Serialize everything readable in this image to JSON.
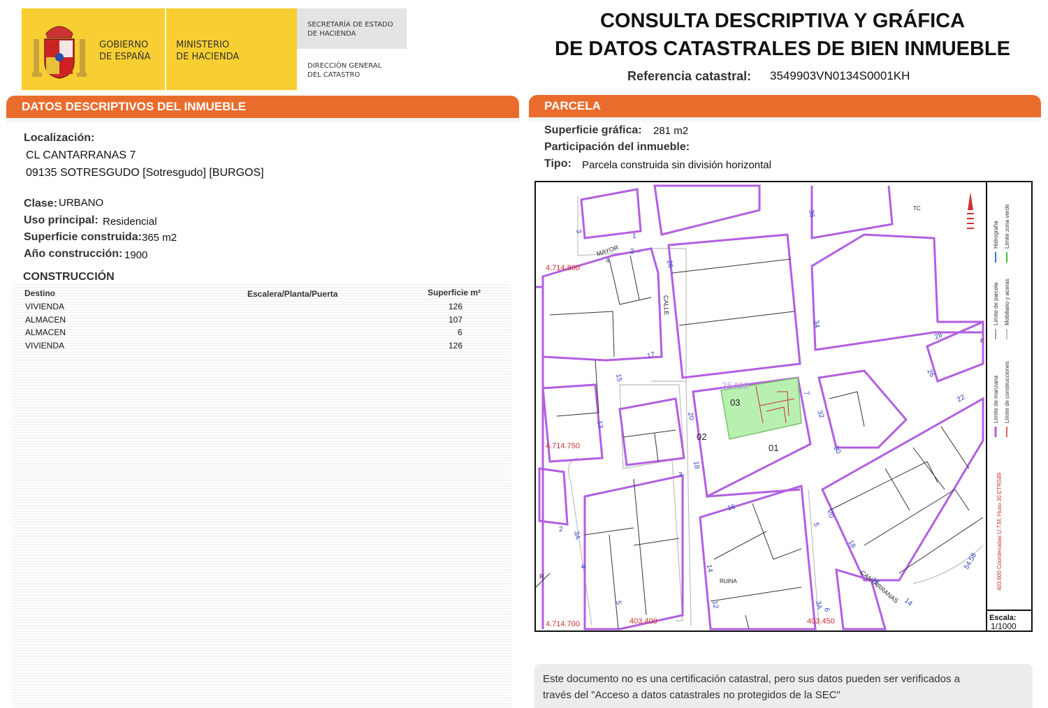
{
  "header": {
    "gobierno": [
      "GOBIERNO",
      "DE ESPAÑA"
    ],
    "ministerio": [
      "MINISTERIO",
      "DE HACIENDA"
    ],
    "secretaria": [
      "SECRETARÍA DE ESTADO",
      "DE HACIENDA"
    ],
    "direccion": [
      "DIRECCIÓN GENERAL",
      "DEL CATASTRO"
    ],
    "title_line1": "CONSULTA DESCRIPTIVA Y GRÁFICA",
    "title_line2": "DE DATOS CATASTRALES DE BIEN INMUEBLE",
    "ref_label": "Referencia catastral:",
    "ref_value": "3549903VN0134S0001KH"
  },
  "left": {
    "section_title": "DATOS DESCRIPTIVOS DEL INMUEBLE",
    "localizacion_label": "Localización:",
    "address_line1": "CL CANTARRANAS 7",
    "address_line2": "09135 SOTRESGUDO [Sotresgudo] [BURGOS]",
    "clase_label": "Clase:",
    "clase_value": "URBANO",
    "uso_label": "Uso principal:",
    "uso_value": "Residencial",
    "superficie_label": "Superficie construida:",
    "superficie_value": "365 m2",
    "anio_label": "Año construcción:",
    "anio_value": "1900",
    "construccion_title": "CONSTRUCCIÓN",
    "table": {
      "headers": [
        "Destino",
        "Escalera/Planta/Puerta",
        "Superficie m²"
      ],
      "rows": [
        {
          "destino": "VIVIENDA",
          "superficie": "126"
        },
        {
          "destino": "ALMACEN",
          "superficie": "107"
        },
        {
          "destino": "ALMACEN",
          "superficie": "6"
        },
        {
          "destino": "VIVIENDA",
          "superficie": "126"
        }
      ]
    }
  },
  "right": {
    "section_title": "PARCELA",
    "sup_grafica_label": "Superficie gráfica:",
    "sup_grafica_value": "281 m2",
    "participacion_label": "Participación del inmueble:",
    "tipo_label": "Tipo:",
    "tipo_value": "Parcela construida sin división horizontal",
    "note_line1": "Este documento no es una certificación catastral, pero sus datos pueden ser verificados a",
    "note_line2": "través del \"Acceso a datos catastrales no protegidos de la SEC\""
  },
  "map": {
    "coords": {
      "y_top": "4.714.800",
      "y_mid": "4.714.750",
      "y_bottom": "4.714.700",
      "x_left": "403.400",
      "x_right": "403.450"
    },
    "street_labels": {
      "mayor": "MAYOR",
      "calle": "CALLE",
      "cantarranas": "CANTARRANAS",
      "ruina": "RUINA"
    },
    "parcel_labels": {
      "p03": "03",
      "p02": "02",
      "p01": "01",
      "ref_partial": "35499",
      "tc": "TC",
      "r": "R",
      "f": "F"
    },
    "number_labels": [
      "1",
      "2",
      "3",
      "4",
      "26",
      "36",
      "34",
      "28",
      "26",
      "22",
      "17",
      "15",
      "13",
      "20",
      "18",
      "16",
      "14",
      "12",
      "5",
      "20",
      "18",
      "16",
      "14",
      "32",
      "30",
      "3",
      "2",
      "4",
      "3A",
      "6",
      "3",
      "7",
      "54.58"
    ],
    "legend": {
      "hidrografia": "Hidrografía",
      "zona_verde": "Límite zona verde",
      "parcela": "Límite de parcela",
      "mobiliario": "Mobiliario y aceras",
      "manzana": "Límite de manzana",
      "construcciones": "Límite de construcciones",
      "coordenadas": "403.600 Coordenadas U.T.M. Huso 30 ETRS89",
      "escala_label": "Escala:",
      "escala_value": "1/1000"
    },
    "colors": {
      "parcel_line": "#b15fe0",
      "highlight": "#b8f0b0",
      "coord_red": "#d03030",
      "number_blue": "#3040c0"
    }
  }
}
